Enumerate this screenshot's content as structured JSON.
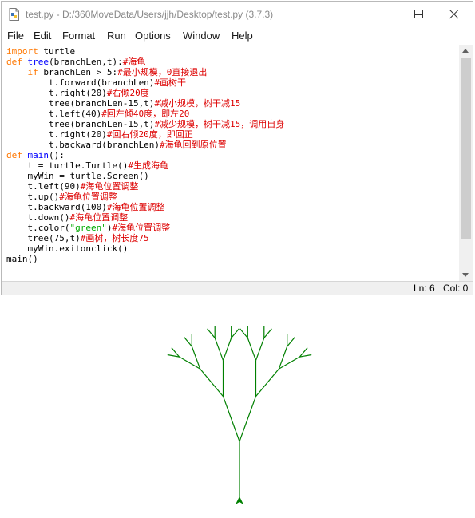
{
  "window": {
    "title": "test.py - D:/360MoveData/Users/jjh/Desktop/test.py (3.7.3)"
  },
  "menu": [
    "File",
    "Edit",
    "Format",
    "Run",
    "Options",
    "Window",
    "Help"
  ],
  "editor": {
    "lines": [
      [
        [
          "kw",
          "import"
        ],
        [
          "n",
          " turtle"
        ]
      ],
      [
        [
          "kw",
          "def"
        ],
        [
          "n",
          " "
        ],
        [
          "def",
          "tree"
        ],
        [
          "n",
          "(branchLen,t):"
        ],
        [
          "cmt",
          "#海龟"
        ]
      ],
      [
        [
          "n",
          "    "
        ],
        [
          "kw",
          "if"
        ],
        [
          "n",
          " branchLen > 5:"
        ],
        [
          "cmt",
          "#最小规模，0直接退出"
        ]
      ],
      [
        [
          "n",
          "        t.forward(branchLen)"
        ],
        [
          "cmt",
          "#画树干"
        ]
      ],
      [
        [
          "n",
          "        t.right(20)"
        ],
        [
          "cmt",
          "#右倾20度"
        ]
      ],
      [
        [
          "n",
          "        tree(branchLen-15,t)"
        ],
        [
          "cmt",
          "#减小规模，树干减15"
        ]
      ],
      [
        [
          "n",
          "        t.left(40)"
        ],
        [
          "cmt",
          "#回左倾40度，即左20"
        ]
      ],
      [
        [
          "n",
          "        tree(branchLen-15,t)"
        ],
        [
          "cmt",
          "#减少规模，树干减15，调用自身"
        ]
      ],
      [
        [
          "n",
          "        t.right(20)"
        ],
        [
          "cmt",
          "#回右倾20度，即回正"
        ]
      ],
      [
        [
          "n",
          "        t.backward(branchLen)"
        ],
        [
          "cmt",
          "#海龟回到原位置"
        ]
      ],
      [
        [
          "kw",
          "def"
        ],
        [
          "n",
          " "
        ],
        [
          "def",
          "main"
        ],
        [
          "n",
          "():"
        ]
      ],
      [
        [
          "n",
          "    t = turtle.Turtle()"
        ],
        [
          "cmt",
          "#生成海龟"
        ]
      ],
      [
        [
          "n",
          "    myWin = turtle.Screen()"
        ]
      ],
      [
        [
          "n",
          "    t.left(90)"
        ],
        [
          "cmt",
          "#海龟位置调整"
        ]
      ],
      [
        [
          "n",
          "    t.up()"
        ],
        [
          "cmt",
          "#海龟位置调整"
        ]
      ],
      [
        [
          "n",
          "    t.backward(100)"
        ],
        [
          "cmt",
          "#海龟位置调整"
        ]
      ],
      [
        [
          "n",
          "    t.down()"
        ],
        [
          "cmt",
          "#海龟位置调整"
        ]
      ],
      [
        [
          "n",
          "    t.color("
        ],
        [
          "str",
          "\"green\""
        ],
        [
          "n",
          ")"
        ],
        [
          "cmt",
          "#海龟位置调整"
        ]
      ],
      [
        [
          "n",
          "    tree(75,t)"
        ],
        [
          "cmt",
          "#画树，树长度75"
        ]
      ],
      [
        [
          "n",
          "    myWin.exitonclick()"
        ]
      ],
      [
        [
          "n",
          "main()"
        ]
      ]
    ]
  },
  "status": {
    "line": "Ln: 6",
    "col": "Col: 0"
  },
  "turtle": {
    "color": "#008000",
    "trunk_length": 75,
    "branch_decrement": 15,
    "branch_angle_deg": 20
  }
}
